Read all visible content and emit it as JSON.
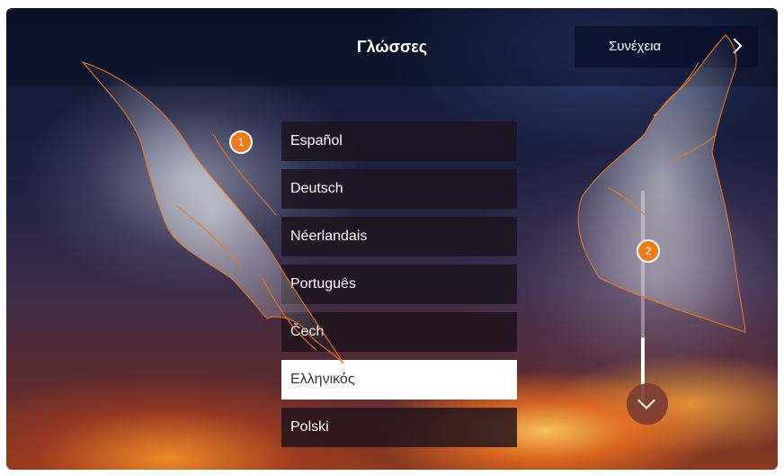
{
  "header": {
    "title": "Γλώσσες",
    "next_label": "Συνέχεια"
  },
  "language_list": {
    "items": [
      {
        "label": "Español",
        "selected": false
      },
      {
        "label": "Deutsch",
        "selected": false
      },
      {
        "label": "Néerlandais",
        "selected": false
      },
      {
        "label": "Português",
        "selected": false
      },
      {
        "label": "Čech",
        "selected": false
      },
      {
        "label": "Ελληνικός",
        "selected": true
      },
      {
        "label": "Polski",
        "selected": false
      }
    ]
  },
  "callouts": {
    "step1": "1",
    "step2": "2"
  },
  "icons": {
    "next": "chevron-right-icon",
    "scroll_down": "chevron-down-icon"
  },
  "colors": {
    "badge": "#f07a18",
    "selected_item_bg": "#ffffff",
    "item_bg": "#1c121c"
  }
}
